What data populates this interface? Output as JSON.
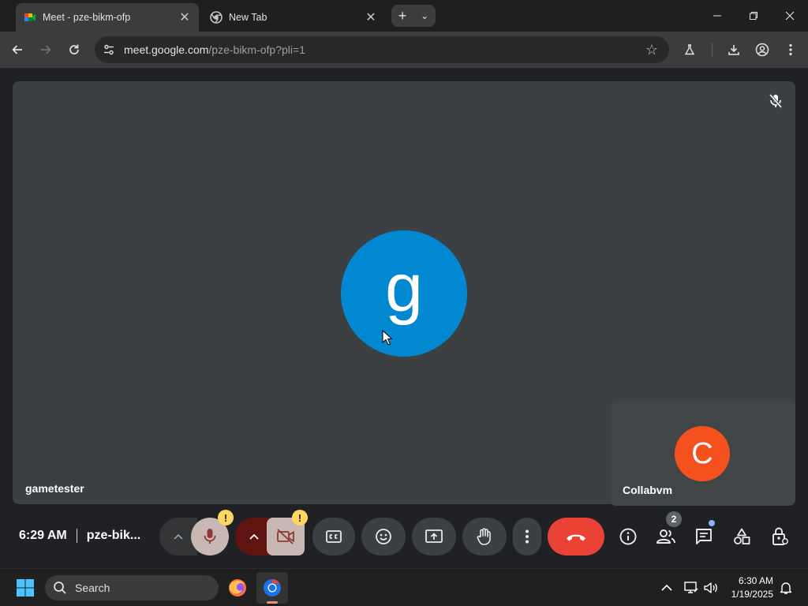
{
  "browser": {
    "tabs": [
      {
        "title": "Meet - pze-bikm-ofp",
        "active": true,
        "favicon": "google-meet-icon"
      },
      {
        "title": "New Tab",
        "active": false,
        "favicon": "chrome-icon"
      }
    ],
    "address": {
      "host": "meet.google.com",
      "path": "/pze-bikm-ofp?pli=1"
    }
  },
  "meeting": {
    "main_participant": {
      "name": "gametester",
      "initial": "g",
      "avatar_color": "#0288d1",
      "muted": true
    },
    "self_participant": {
      "name": "Collabvm",
      "initial": "C",
      "avatar_color": "#f4511e"
    },
    "time": "6:29 AM",
    "code": "pze-bik...",
    "participant_count": "2",
    "end_call_color": "#ea4335"
  },
  "taskbar": {
    "search_label": "Search",
    "time": "6:30 AM",
    "date": "1/19/2025"
  }
}
